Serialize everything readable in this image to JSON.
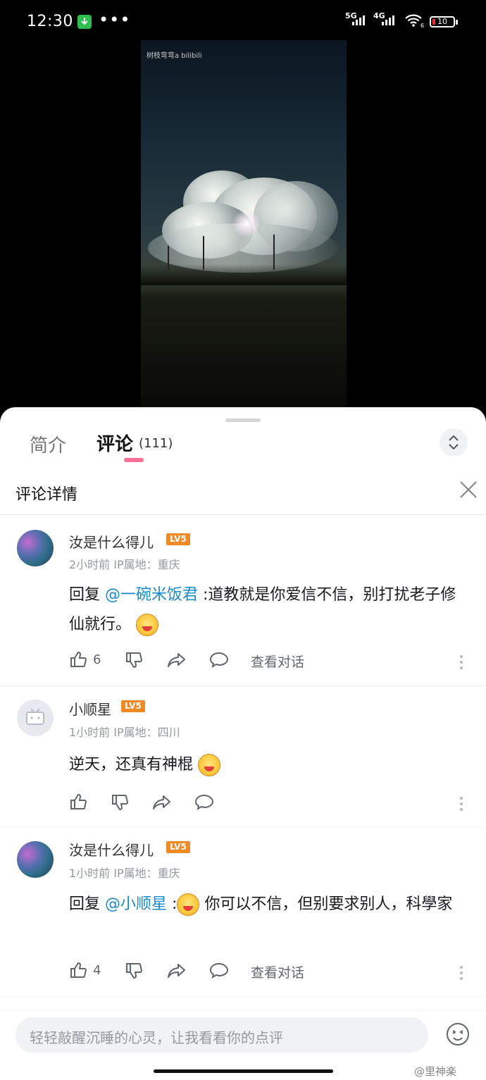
{
  "status_bar": {
    "time": "12:30",
    "dots": "•••",
    "network_1": "5G",
    "network_2": "4G",
    "battery": "10",
    "wifi_badge": "6"
  },
  "video": {
    "watermark": "树枝弯弯a bilibili"
  },
  "tabs": {
    "intro": "简介",
    "comments": "评论",
    "comment_count": "(111)"
  },
  "detail": {
    "title": "评论详情"
  },
  "comments": [
    {
      "user": "汝是什么得儿",
      "level": "LV5",
      "meta": "2小时前 IP属地：重庆",
      "prefix": "回复 ",
      "mention": "@一碗米饭君",
      "text": " :道教就是你爱信不信，别打扰老子修仙就行。",
      "likes": "6",
      "view_conversation": "查看对话"
    },
    {
      "user": "小顺星",
      "level": "LV5",
      "meta": "1小时前 IP属地：四川",
      "text": "逆天，还真有神棍"
    },
    {
      "user": "汝是什么得儿",
      "level": "LV5",
      "meta": "1小时前 IP属地：重庆",
      "prefix": "回复 ",
      "mention": "@小顺星",
      "text_a": " :",
      "text_b": " 你可以不信，但别要求别人，科學家",
      "likes": "4",
      "view_conversation": "查看对话"
    }
  ],
  "reply_bar": {
    "placeholder": "轻轻敲醒沉睡的心灵，让我看看你的点评"
  },
  "watermark_corner": "@里神楽"
}
